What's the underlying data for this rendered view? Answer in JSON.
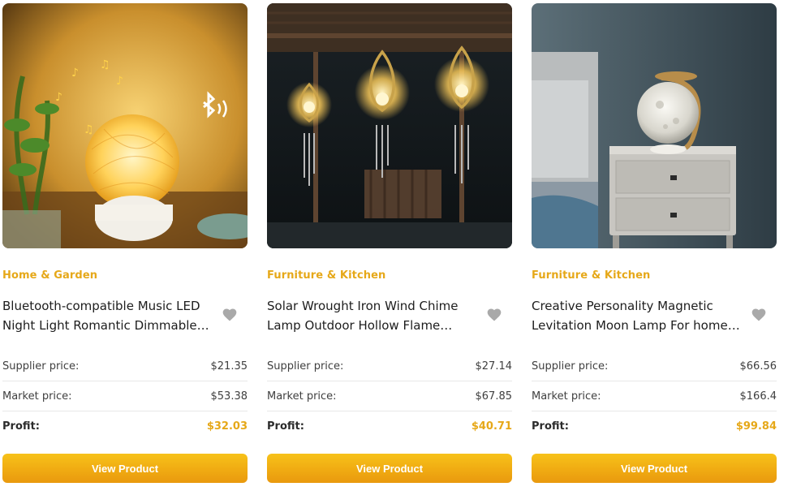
{
  "products": [
    {
      "image_icon": "ball-night-light-image",
      "category": "Home & Garden",
      "title": "Bluetooth-compatible Music LED Night Light Romantic Dimmable Rattan Ball Lamp",
      "labels": {
        "supplier": "Supplier price:",
        "market": "Market price:",
        "profit": "Profit:"
      },
      "supplier_price": "$21.35",
      "market_price": "$53.38",
      "profit": "$32.03",
      "button": "View Product"
    },
    {
      "image_icon": "wind-chime-lamp-image",
      "category": "Furniture & Kitchen",
      "title": "Solar Wrought Iron Wind Chime Lamp Outdoor Hollow Flame Shape Garden Light",
      "labels": {
        "supplier": "Supplier price:",
        "market": "Market price:",
        "profit": "Profit:"
      },
      "supplier_price": "$27.14",
      "market_price": "$67.85",
      "profit": "$40.71",
      "button": "View Product"
    },
    {
      "image_icon": "moon-lamp-image",
      "category": "Furniture & Kitchen",
      "title": "Creative Personality Magnetic Levitation Moon Lamp For home decoration",
      "labels": {
        "supplier": "Supplier price:",
        "market": "Market price:",
        "profit": "Profit:"
      },
      "supplier_price": "$66.56",
      "market_price": "$166.4",
      "profit": "$99.84",
      "button": "View Product"
    }
  ],
  "colors": {
    "accent": "#e6a819",
    "button_top": "#f7c21a",
    "button_bottom": "#e9990e"
  }
}
